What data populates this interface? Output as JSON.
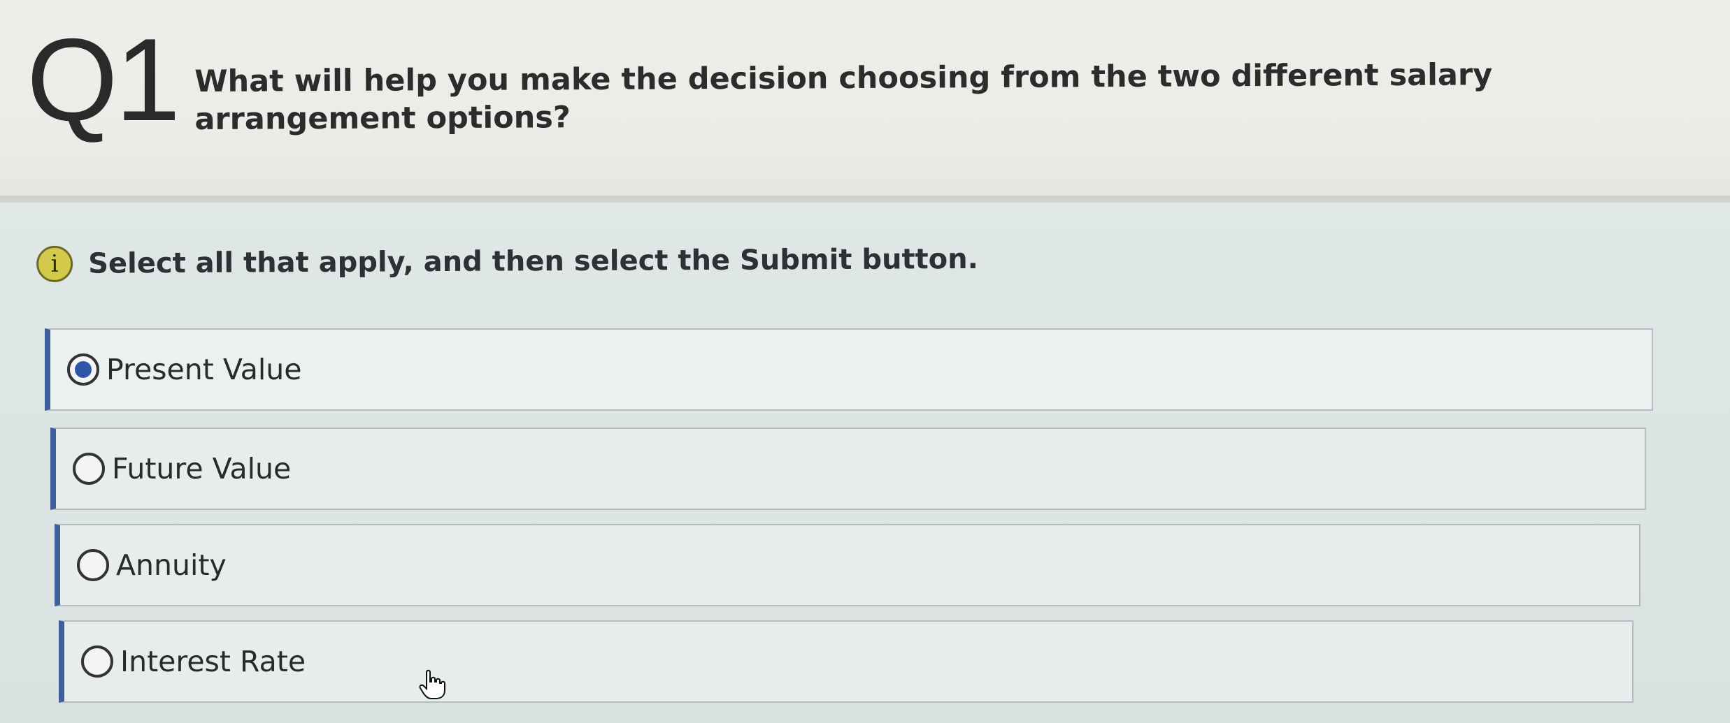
{
  "question": {
    "number": "Q1",
    "text": "What will help you make the decision choosing from the two different salary arrangement options?"
  },
  "instruction": {
    "icon": "info-icon",
    "icon_glyph": "i",
    "text": "Select all that apply, and then select the Submit button."
  },
  "options": [
    {
      "label": "Present Value",
      "selected": true
    },
    {
      "label": "Future Value",
      "selected": false
    },
    {
      "label": "Annuity",
      "selected": false
    },
    {
      "label": "Interest Rate",
      "selected": false
    }
  ],
  "colors": {
    "accent": "#3f5f9a",
    "radio_selected": "#2d56a8",
    "info_icon": "#d3c94a"
  }
}
